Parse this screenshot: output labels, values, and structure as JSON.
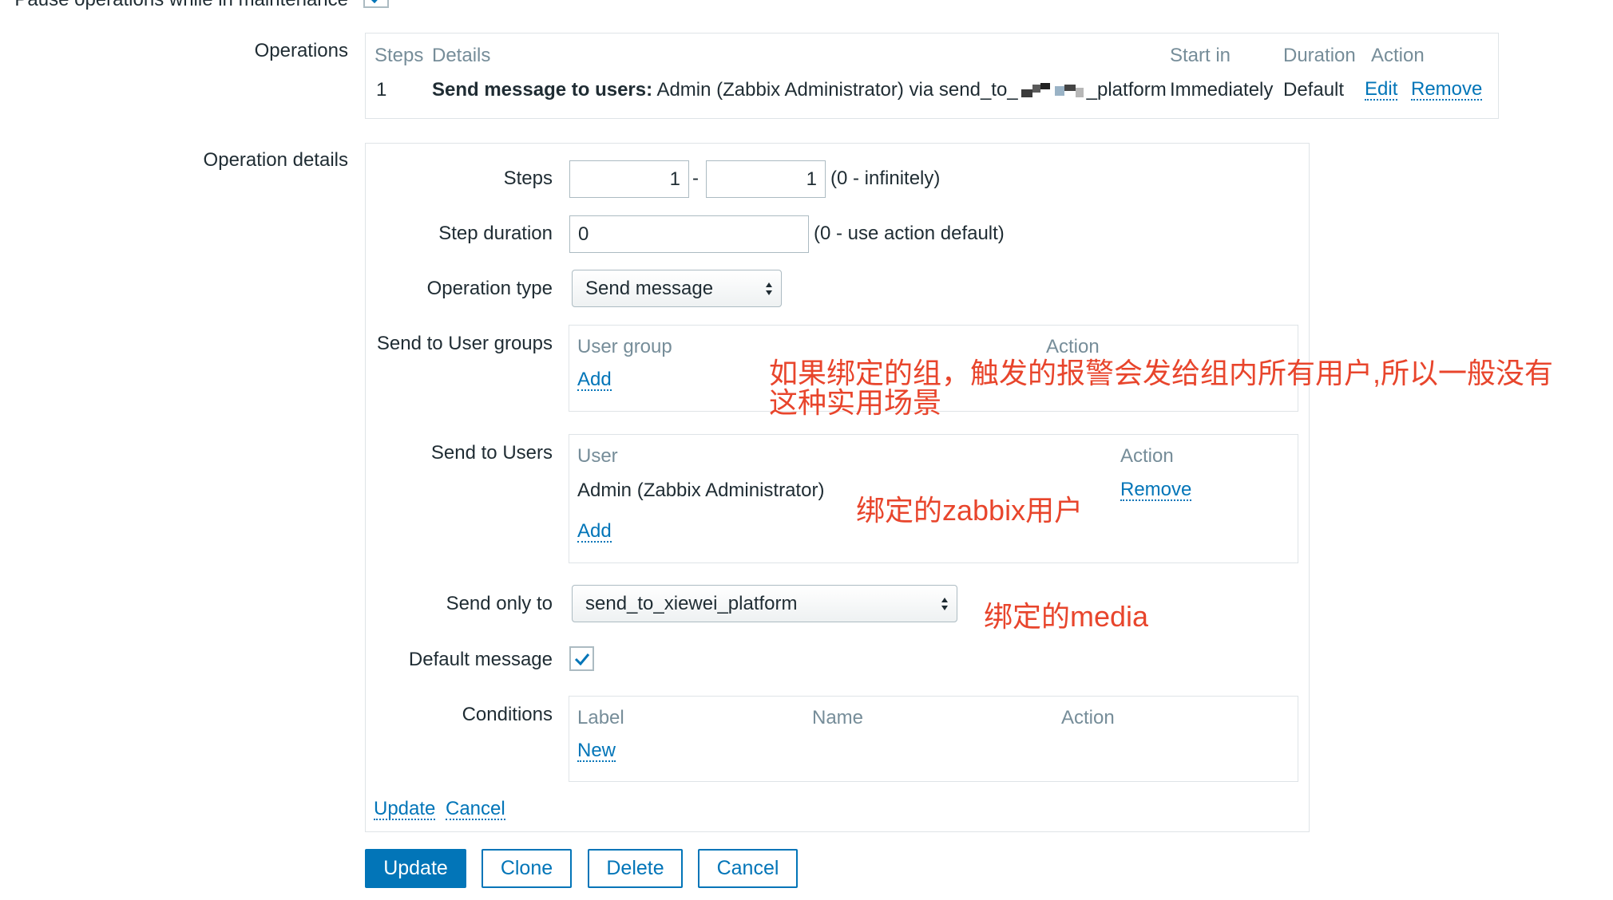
{
  "top_row": {
    "label": "Pause operations while in maintenance"
  },
  "operations": {
    "label": "Operations",
    "headers": {
      "steps": "Steps",
      "details": "Details",
      "start_in": "Start in",
      "duration": "Duration",
      "action": "Action"
    },
    "rows": [
      {
        "step": "1",
        "details_bold": "Send message to users:",
        "details_rest_prefix": "Admin (Zabbix Administrator) via send_to_",
        "details_rest_suffix": "_platform",
        "start_in": "Immediately",
        "duration": "Default",
        "edit": "Edit",
        "remove": "Remove"
      }
    ]
  },
  "operation_details": {
    "label": "Operation details",
    "steps": {
      "label": "Steps",
      "from": "1",
      "separator": "-",
      "to": "1",
      "hint": "(0 - infinitely)"
    },
    "step_duration": {
      "label": "Step duration",
      "value": "0",
      "hint": "(0 - use action default)"
    },
    "operation_type": {
      "label": "Operation type",
      "value": "Send message"
    },
    "user_groups": {
      "label": "Send to User groups",
      "col_group": "User group",
      "col_action": "Action",
      "add": "Add"
    },
    "users": {
      "label": "Send to Users",
      "col_user": "User",
      "col_action": "Action",
      "rows": [
        {
          "user": "Admin (Zabbix Administrator)",
          "remove": "Remove"
        }
      ],
      "add": "Add"
    },
    "send_only_to": {
      "label": "Send only to",
      "value": "send_to_xiewei_platform"
    },
    "default_message": {
      "label": "Default message",
      "checked": true
    },
    "conditions": {
      "label": "Conditions",
      "col_label": "Label",
      "col_name": "Name",
      "col_action": "Action",
      "new": "New"
    },
    "links": {
      "update": "Update",
      "cancel": "Cancel"
    }
  },
  "annotations": {
    "groups_note_line1": "如果绑定的组，触发的报警会发给组内所有用户,所以一般没有",
    "groups_note_line2": "这种实用场景",
    "users_note": "绑定的zabbix用户",
    "media_note": "绑定的media"
  },
  "buttons": {
    "update": "Update",
    "clone": "Clone",
    "delete": "Delete",
    "cancel": "Cancel"
  },
  "colors": {
    "link": "#0275b8",
    "annotation": "#e8452c",
    "border": "#dfe4e7",
    "input_border": "#acbbc2"
  }
}
